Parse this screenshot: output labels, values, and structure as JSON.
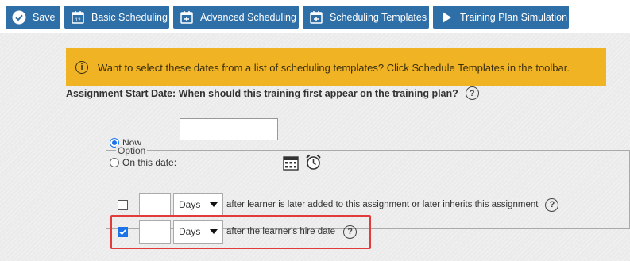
{
  "toolbar": {
    "buttons": [
      {
        "label": "Save",
        "icon": "check-circle-icon"
      },
      {
        "label": "Basic Scheduling",
        "icon": "calendar-12-icon"
      },
      {
        "label": "Advanced Scheduling",
        "icon": "calendar-plus-icon"
      },
      {
        "label": "Scheduling Templates",
        "icon": "calendar-plus-icon"
      },
      {
        "label": "Training Plan Simulation",
        "icon": "play-icon"
      }
    ]
  },
  "banner": {
    "text": "Want to select these dates from a list of scheduling templates? Click Schedule Templates in the toolbar.",
    "color": "#f0b323"
  },
  "start_date": {
    "question": "Assignment Start Date: When should this training first appear on the training plan?",
    "option_now": "Now",
    "option_on_date": "On this date:",
    "selected": "Now",
    "date_value": ""
  },
  "options": {
    "legend": "Option",
    "rows": [
      {
        "checked": false,
        "number": "",
        "unit": "Days",
        "text": "after learner is later added to this assignment or later inherits this assignment"
      },
      {
        "checked": true,
        "number": "",
        "unit": "Days",
        "text": "after the learner's hire date"
      }
    ]
  },
  "colors": {
    "toolbar_button": "#2f6fa8",
    "highlight": "#e23b3b",
    "checkbox": "#1a73e8"
  }
}
